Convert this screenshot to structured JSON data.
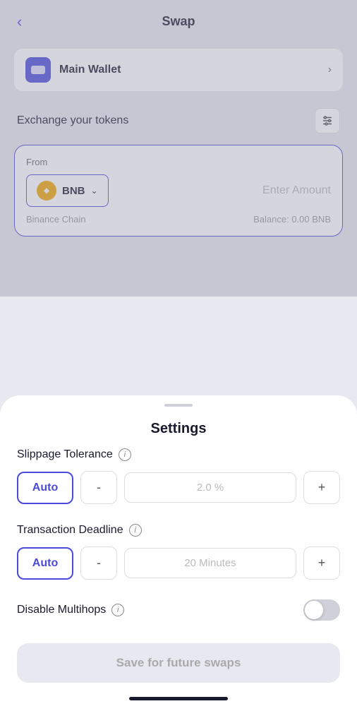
{
  "header": {
    "title": "Swap",
    "back_icon": "‹"
  },
  "wallet": {
    "name": "Main Wallet",
    "chevron": "›"
  },
  "exchange": {
    "label": "Exchange your tokens"
  },
  "swap_card": {
    "from_label": "From",
    "token_name": "BNB",
    "enter_amount_placeholder": "Enter Amount",
    "bottom_left": "Binance Chain",
    "bottom_right": "Balance: 0.00 BNB"
  },
  "settings_sheet": {
    "title": "Settings",
    "slippage": {
      "label": "Slippage Tolerance",
      "info": "i",
      "auto_label": "Auto",
      "minus_label": "-",
      "value": "2.0 %",
      "plus_label": "+"
    },
    "deadline": {
      "label": "Transaction Deadline",
      "info": "i",
      "auto_label": "Auto",
      "minus_label": "-",
      "value": "20 Minutes",
      "plus_label": "+"
    },
    "multihops": {
      "label": "Disable Multihops",
      "info": "i",
      "toggle_state": false
    },
    "save_button": "Save for future swaps"
  },
  "icons": {
    "settings": "⇌",
    "chevron_down": "∨"
  }
}
